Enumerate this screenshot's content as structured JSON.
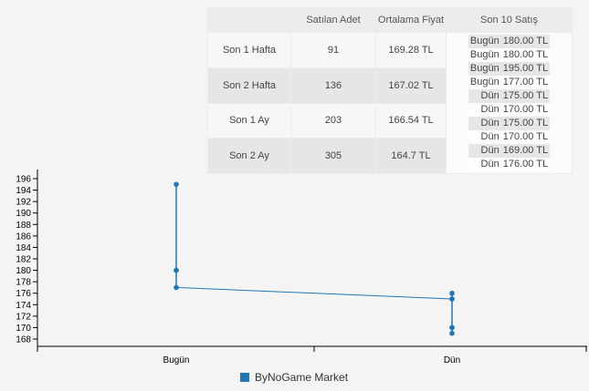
{
  "stats": {
    "headers": [
      "",
      "Satılan Adet",
      "Ortalama Fiyat",
      "Son 10 Satış"
    ],
    "rows": [
      {
        "period": "Son 1 Hafta",
        "count": "91",
        "avg": "169.28 TL"
      },
      {
        "period": "Son 2 Hafta",
        "count": "136",
        "avg": "167.02 TL"
      },
      {
        "period": "Son 1 Ay",
        "count": "203",
        "avg": "166.54 TL"
      },
      {
        "period": "Son 2 Ay",
        "count": "305",
        "avg": "164.7 TL"
      }
    ],
    "last_sales": [
      {
        "day": "Bugün",
        "price": "180.00 TL"
      },
      {
        "day": "Bugün",
        "price": "180.00 TL"
      },
      {
        "day": "Bugün",
        "price": "195.00 TL"
      },
      {
        "day": "Bugün",
        "price": "177.00 TL"
      },
      {
        "day": "Dün",
        "price": "175.00 TL"
      },
      {
        "day": "Dün",
        "price": "170.00 TL"
      },
      {
        "day": "Dün",
        "price": "175.00 TL"
      },
      {
        "day": "Dün",
        "price": "170.00 TL"
      },
      {
        "day": "Dün",
        "price": "169.00 TL"
      },
      {
        "day": "Dün",
        "price": "176.00 TL"
      }
    ]
  },
  "chart_data": {
    "type": "line",
    "categories": [
      "Bugün",
      "Dün"
    ],
    "ylim": [
      167,
      196
    ],
    "yticks": [
      168,
      170,
      172,
      174,
      176,
      178,
      180,
      182,
      184,
      186,
      188,
      190,
      192,
      194,
      196
    ],
    "series": [
      {
        "name": "ByNoGame Market",
        "points": [
          {
            "x": "Bugün",
            "values": [
              195,
              180,
              180,
              177
            ]
          },
          {
            "x": "Dün",
            "values": [
              176,
              175,
              175,
              170,
              170,
              169
            ]
          }
        ],
        "line": [
          {
            "x": "Bugün",
            "y": 177
          },
          {
            "x": "Dün",
            "y": 175
          }
        ]
      }
    ],
    "legend": "bottom",
    "grid": false
  },
  "colors": {
    "series": "#1f77b4",
    "axis": "#000000"
  }
}
